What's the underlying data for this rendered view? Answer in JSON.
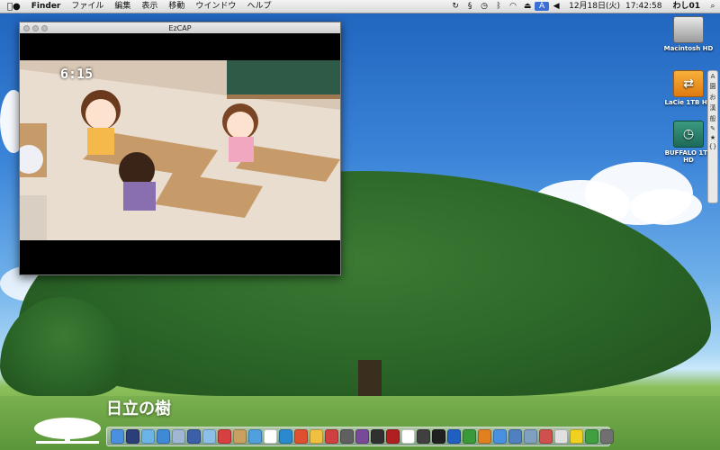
{
  "menubar": {
    "apple": "",
    "app": "Finder",
    "items": [
      "ファイル",
      "編集",
      "表示",
      "移動",
      "ウインドウ",
      "ヘルプ"
    ],
    "status_icons": [
      "sync-icon",
      "script-icon",
      "timemachine-icon",
      "bluetooth-icon",
      "wifi-icon",
      "eject-icon",
      "input-method-icon",
      "volume-icon"
    ],
    "input_method": "A",
    "date": "12月18日(火)",
    "time": "17:42:58",
    "user": "わし01"
  },
  "window": {
    "title": "EzCAP",
    "timestamp": "6:15"
  },
  "desktop_icons": [
    {
      "label": "Macintosh HD",
      "icon": "hard-drive-icon"
    },
    {
      "label": "LaCie 1TB HD",
      "icon": "usb-drive-icon"
    },
    {
      "label": "BUFFALO 1TB HD",
      "icon": "timemachine-drive-icon"
    }
  ],
  "palette": {
    "items": [
      "A",
      "園",
      "お",
      "漢",
      "般"
    ]
  },
  "brand_text": "日立の樹",
  "dock": {
    "items": [
      {
        "name": "finder",
        "color": "#4a8fe0"
      },
      {
        "name": "dashboard",
        "color": "#2c3e7a"
      },
      {
        "name": "itunes",
        "color": "#6cb4e8"
      },
      {
        "name": "safari",
        "color": "#3f8ad6"
      },
      {
        "name": "mail",
        "color": "#9fb6d4"
      },
      {
        "name": "app6",
        "color": "#3b5fa8"
      },
      {
        "name": "app7",
        "color": "#8dc0e8"
      },
      {
        "name": "ical",
        "color": "#d64040"
      },
      {
        "name": "app9",
        "color": "#c8a060"
      },
      {
        "name": "app10",
        "color": "#50a0e0"
      },
      {
        "name": "app11",
        "color": "#ffffff"
      },
      {
        "name": "app12",
        "color": "#2a8ad0"
      },
      {
        "name": "app13",
        "color": "#e05030"
      },
      {
        "name": "app14",
        "color": "#f0c040"
      },
      {
        "name": "app15",
        "color": "#d04040"
      },
      {
        "name": "app16",
        "color": "#606060"
      },
      {
        "name": "app17",
        "color": "#7a4a9a"
      },
      {
        "name": "app18",
        "color": "#303030"
      },
      {
        "name": "app19",
        "color": "#b02020"
      },
      {
        "name": "app20",
        "color": "#ffffff"
      },
      {
        "name": "app21",
        "color": "#404040"
      },
      {
        "name": "app22",
        "color": "#202020"
      },
      {
        "name": "app23",
        "color": "#2060c0"
      },
      {
        "name": "app24",
        "color": "#3a9a3a"
      },
      {
        "name": "app25",
        "color": "#e08020"
      },
      {
        "name": "app26",
        "color": "#4a90e0"
      },
      {
        "name": "app27",
        "color": "#5080c0"
      },
      {
        "name": "app28",
        "color": "#80a0c0"
      },
      {
        "name": "app29",
        "color": "#d05050"
      },
      {
        "name": "app30",
        "color": "#e0e0e0"
      },
      {
        "name": "app31",
        "color": "#f0d020"
      },
      {
        "name": "app32",
        "color": "#40a040"
      },
      {
        "name": "trash",
        "color": "#707070"
      }
    ]
  }
}
